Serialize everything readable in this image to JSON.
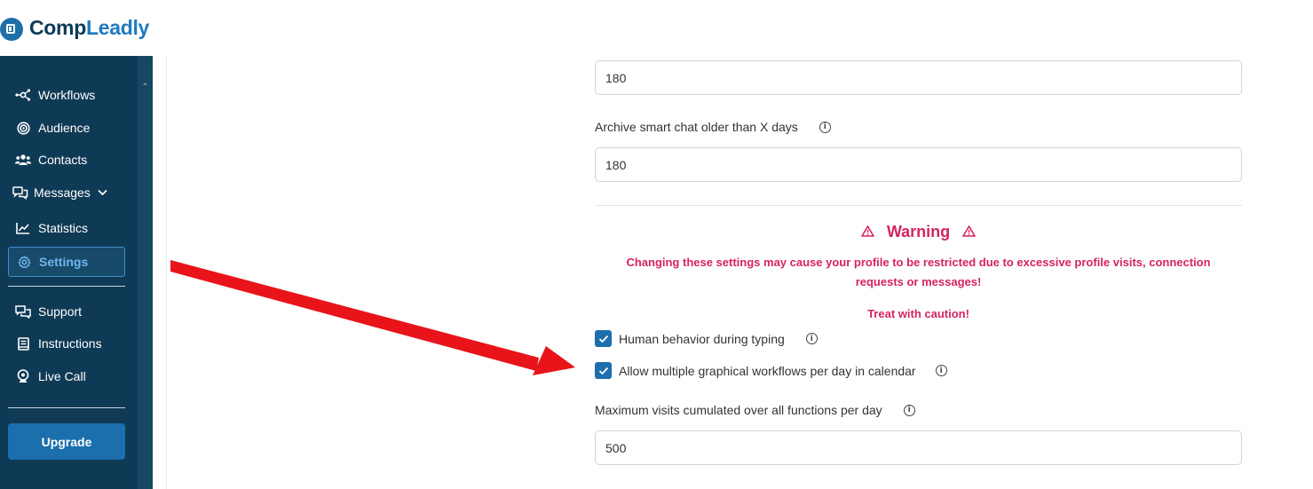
{
  "brand": {
    "name_part1": "Comp",
    "name_part2": "Leadly"
  },
  "sidebar": {
    "items": [
      {
        "label": "Workflows",
        "icon": "workflow-icon"
      },
      {
        "label": "Audience",
        "icon": "target-icon"
      },
      {
        "label": "Contacts",
        "icon": "users-icon"
      },
      {
        "label": "Messages",
        "icon": "messages-icon"
      },
      {
        "label": "Statistics",
        "icon": "chart-icon"
      },
      {
        "label": "Settings",
        "icon": "gear-icon",
        "active": true
      },
      {
        "label": "Support",
        "icon": "support-icon"
      },
      {
        "label": "Instructions",
        "icon": "book-icon"
      },
      {
        "label": "Live Call",
        "icon": "webcam-icon"
      }
    ],
    "upgrade_label": "Upgrade"
  },
  "form": {
    "top_input_value": "180",
    "archive_label": "Archive smart chat older than X days",
    "archive_value": "180",
    "warning_title": "Warning",
    "warning_text_line1": "Changing these settings may cause your profile to be restricted due to excessive profile visits, connection",
    "warning_text_line2": "requests or messages!",
    "caution_text": "Treat with caution!",
    "checkbox1_label": "Human behavior during typing",
    "checkbox1_checked": true,
    "checkbox2_label": "Allow multiple graphical workflows per day in calendar",
    "checkbox2_checked": true,
    "max_visits_label": "Maximum visits cumulated over all functions per day",
    "max_visits_value": "500"
  },
  "colors": {
    "sidebar_bg": "#0f3a55",
    "accent": "#1b6fad",
    "warning": "#d6245c",
    "annotation_arrow": "#e8141a"
  }
}
